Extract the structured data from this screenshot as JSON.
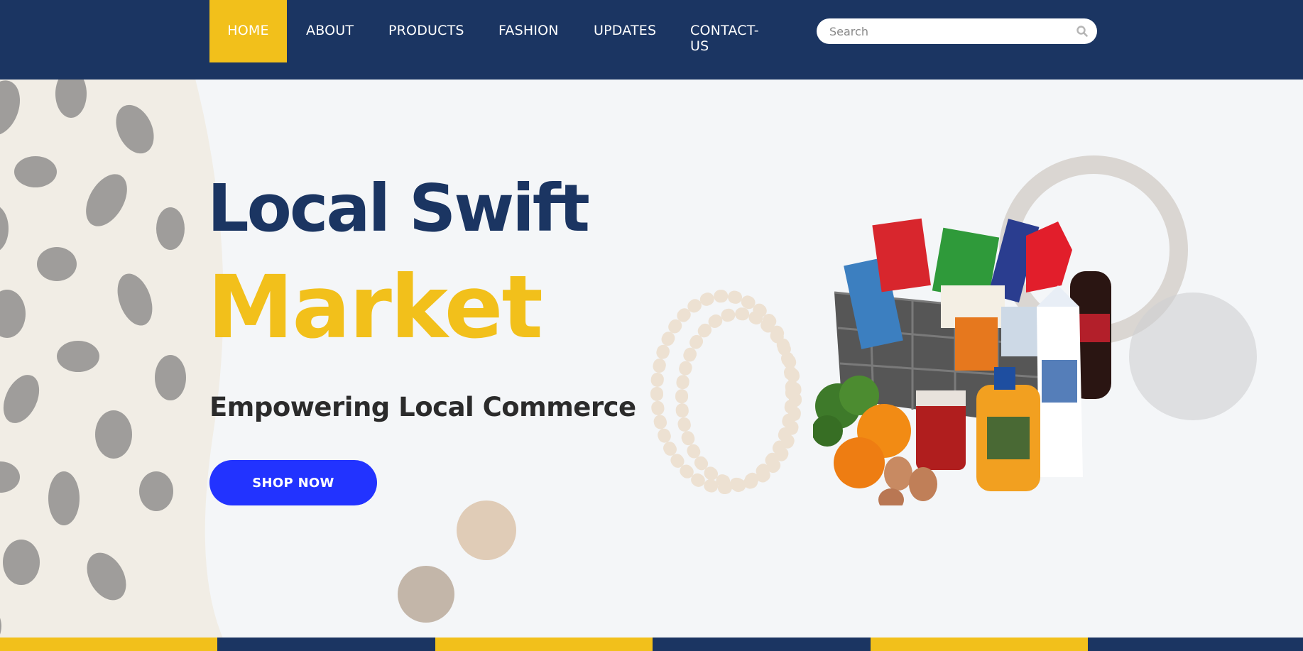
{
  "nav": {
    "items": [
      {
        "label": "HOME",
        "active": true
      },
      {
        "label": "ABOUT",
        "active": false
      },
      {
        "label": "PRODUCTS",
        "active": false
      },
      {
        "label": "FASHION",
        "active": false
      },
      {
        "label": "UPDATES",
        "active": false
      },
      {
        "label": "CONTACT-US",
        "label_line1": "CONTACT-",
        "label_line2": "US",
        "active": false
      }
    ],
    "search": {
      "placeholder": "Search",
      "value": "",
      "icon": "search-icon"
    }
  },
  "hero": {
    "title_line1": "Local Swift",
    "title_line2": "Market",
    "subtitle": "Empowering Local Commerce",
    "cta_label": "SHOP NOW",
    "image": "grocery-basket"
  },
  "colors": {
    "navy": "#1b3562",
    "yellow": "#f2c01b",
    "button_blue": "#2233ff",
    "subtitle": "#2b2b2b"
  },
  "footer_stripes": [
    "#f2c01b",
    "#1b3562",
    "#f2c01b",
    "#1b3562",
    "#f2c01b",
    "#1b3562"
  ]
}
